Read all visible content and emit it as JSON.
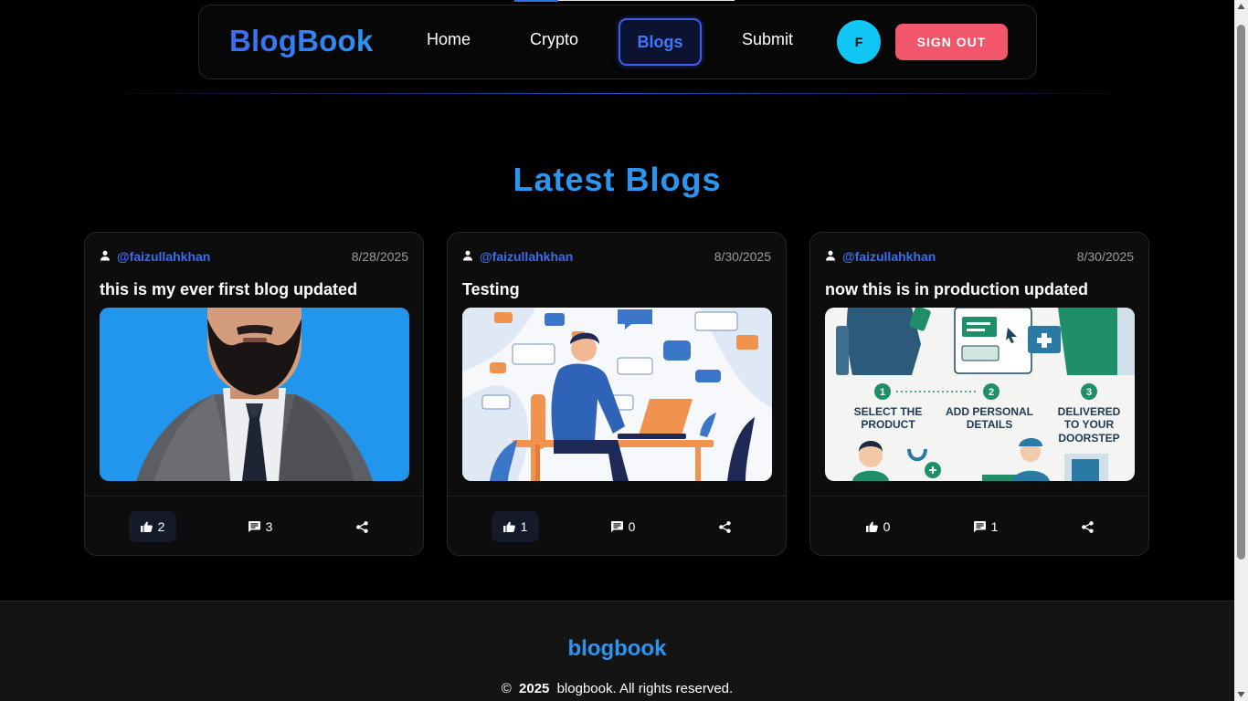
{
  "nav": {
    "brand": "BlogBook",
    "links": [
      {
        "label": "Home"
      },
      {
        "label": "Crypto"
      },
      {
        "label": "Blogs",
        "active": true
      },
      {
        "label": "Submit"
      }
    ],
    "avatar_initial": "F",
    "signout_label": "SIGN OUT"
  },
  "main": {
    "title": "Latest Blogs",
    "cards": [
      {
        "username": "@faizullahkhan",
        "date": "8/28/2025",
        "title": "this is my ever first blog updated",
        "likes": "2",
        "comments": "3",
        "liked": true
      },
      {
        "username": "@faizullahkhan",
        "date": "8/30/2025",
        "title": "Testing",
        "likes": "1",
        "comments": "0",
        "liked": true
      },
      {
        "username": "@faizullahkhan",
        "date": "8/30/2025",
        "title": "now this is in production updated",
        "likes": "0",
        "comments": "1",
        "liked": false
      }
    ],
    "card3_image_text": {
      "step1_num": "1",
      "step1": "SELECT THE",
      "step1b": "PRODUCT",
      "step2_num": "2",
      "step2": "ADD PERSONAL",
      "step2b": "DETAILS",
      "step3_num": "3",
      "step3": "DELIVERED",
      "step3b": "TO YOUR",
      "step3c": "DOORSTEP"
    }
  },
  "footer": {
    "brand": "blogbook",
    "copy_symbol": "©",
    "year": "2025",
    "copy_text": "blogbook. All rights reserved."
  },
  "colors": {
    "accent": "#2a96f0",
    "brand_start": "#3d6bf0",
    "signout": "#f2566a",
    "avatar": "#11c6f4",
    "username": "#3a6bf2"
  },
  "icons": [
    "user-icon",
    "thumbs-up-icon",
    "comment-icon",
    "share-icon"
  ]
}
